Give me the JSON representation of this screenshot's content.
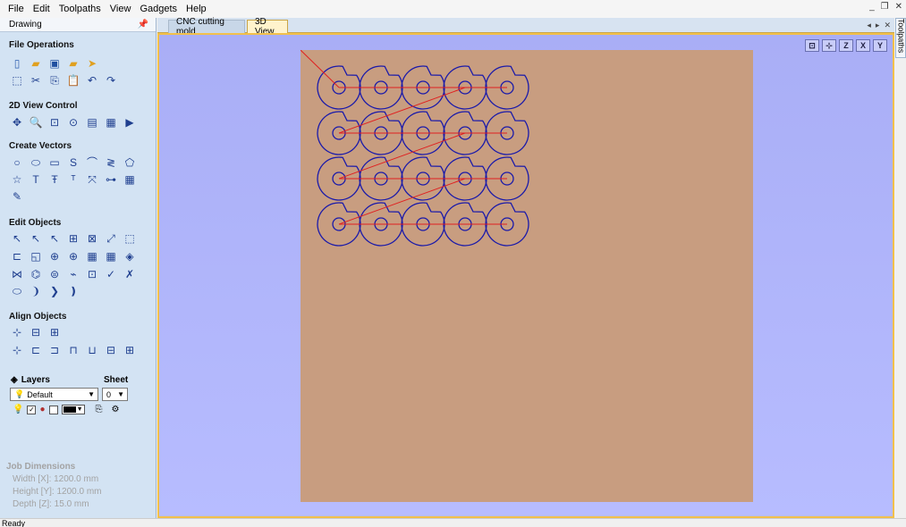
{
  "menu": [
    "File",
    "Edit",
    "Toolpaths",
    "View",
    "Gadgets",
    "Help"
  ],
  "panel": {
    "title": "Drawing",
    "sections": {
      "file_operations": "File Operations",
      "view_control": "2D View Control",
      "create_vectors": "Create Vectors",
      "edit_objects": "Edit Objects",
      "align_objects": "Align Objects"
    },
    "layers": {
      "title": "Layers",
      "selected": "Default",
      "sheet_title": "Sheet",
      "sheet_value": "0"
    },
    "job_dimensions": {
      "title": "Job Dimensions",
      "width": "Width  [X]: 1200.0 mm",
      "height": "Height [Y]: 1200.0 mm",
      "depth": "Depth  [Z]: 15.0 mm"
    }
  },
  "tabs": [
    "CNC cutting mold",
    "3D View"
  ],
  "active_tab": "3D View",
  "right_tab": "Toolpaths",
  "view_tools": [
    "Z",
    "X",
    "Y"
  ],
  "status": "Ready",
  "colors": {
    "board": "#c89d80",
    "viewport": "#b0b5fb",
    "vector": "#1a1aaa",
    "toolpath": "#e02020"
  }
}
